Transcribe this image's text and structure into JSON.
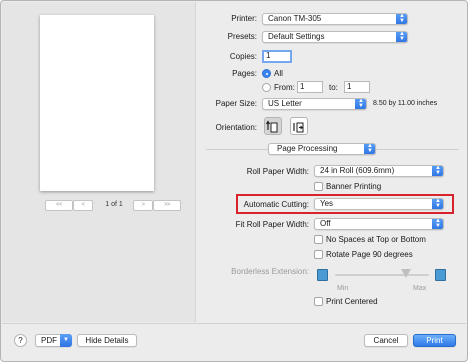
{
  "preview": {
    "prev_first": "<<",
    "prev": "<",
    "page_indicator": "1 of 1",
    "next": ">",
    "next_last": ">>"
  },
  "printer": {
    "label": "Printer:",
    "value": "Canon TM-305"
  },
  "presets": {
    "label": "Presets:",
    "value": "Default Settings"
  },
  "copies": {
    "label": "Copies:",
    "value": "1"
  },
  "pages": {
    "label": "Pages:",
    "all_label": "All",
    "from_label": "From:",
    "from_value": "1",
    "to_label": "to:",
    "to_value": "1"
  },
  "paper_size": {
    "label": "Paper Size:",
    "value": "US Letter",
    "dimensions": "8.50 by 11.00 inches"
  },
  "orientation": {
    "label": "Orientation:"
  },
  "section": {
    "value": "Page Processing"
  },
  "roll_paper_width": {
    "label": "Roll Paper Width:",
    "value": "24 in Roll (609.6mm)"
  },
  "banner_printing": {
    "label": "Banner Printing"
  },
  "automatic_cutting": {
    "label": "Automatic Cutting:",
    "value": "Yes"
  },
  "fit_roll_paper_width": {
    "label": "Fit Roll Paper Width:",
    "value": "Off"
  },
  "no_spaces": {
    "label": "No Spaces at Top or Bottom"
  },
  "rotate_page": {
    "label": "Rotate Page 90 degrees"
  },
  "borderless": {
    "label": "Borderless Extension:",
    "min_label": "Min",
    "max_label": "Max",
    "level": 0.75
  },
  "print_centered": {
    "label": "Print Centered"
  },
  "footer": {
    "help": "?",
    "pdf": "PDF",
    "hide_details": "Hide Details",
    "cancel": "Cancel",
    "print": "Print"
  },
  "colors": {
    "accent": "#2f7ae8",
    "highlight": "#d9232c"
  }
}
